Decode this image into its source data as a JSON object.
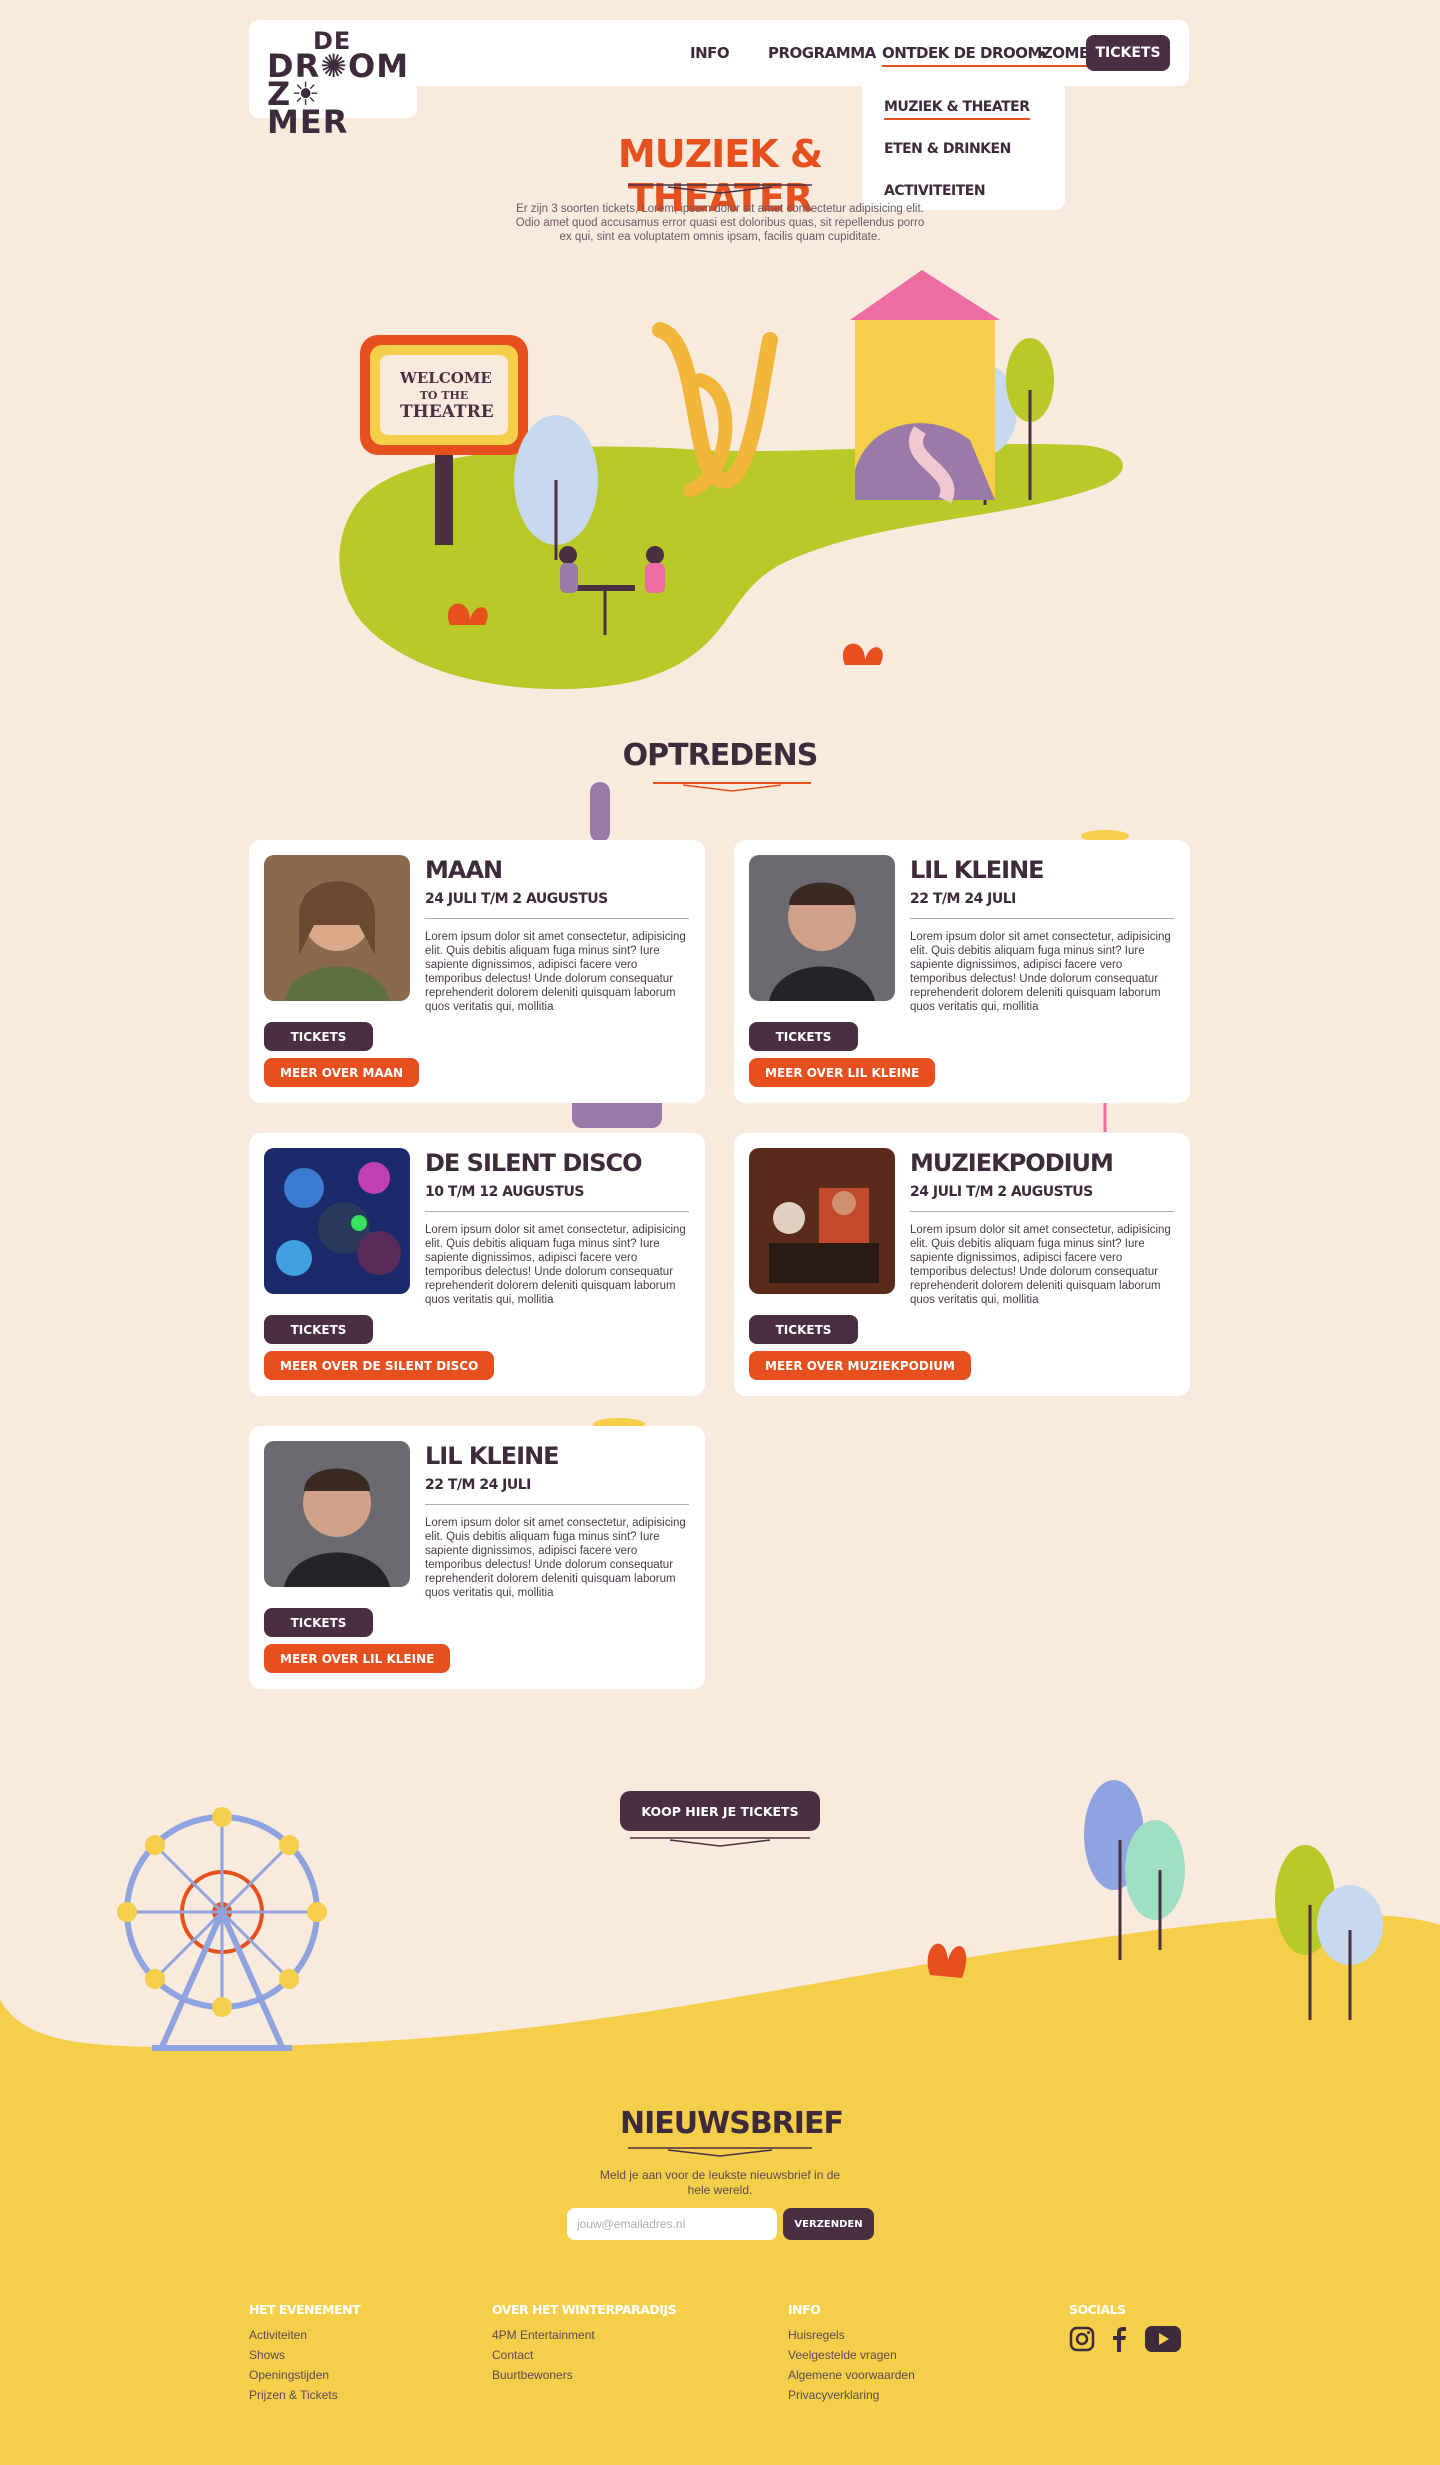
{
  "header": {
    "logo_lines": [
      "DE",
      "DR✺OM",
      "Z☀MER"
    ],
    "nav": [
      "INFO",
      "PROGRAMMA",
      "ONTDEK DE DROOMZOMER"
    ],
    "tickets_label": "TICKETS",
    "dropdown": [
      "MUZIEK & THEATER",
      "ETEN & DRINKEN",
      "ACTIVITEITEN"
    ]
  },
  "hero": {
    "title": "MUZIEK & THEATER",
    "text": "Er zijn 3 soorten tickets, Lorem, ipsum dolor sit amet consectetur adipisicing elit. Odio amet quod accusamus error quasi est doloribus quas, sit repellendus porro ex qui, sint ea voluptatem omnis ipsam, facilis quam cupiditate.",
    "sign": [
      "WELCOME",
      "TO THE",
      "THEATRE"
    ]
  },
  "section_title": "OPTREDENS",
  "cards": [
    {
      "name": "MAAN",
      "date": "24 JULI T/M 2 AUGUSTUS",
      "text": "Lorem ipsum dolor sit amet consectetur, adipisicing elit. Quis debitis aliquam fuga minus sint? Iure sapiente dignissimos, adipisci facere vero temporibus delectus! Unde dolorum consequatur reprehenderit dolorem deleniti quisquam laborum quos veritatis qui, mollitia",
      "tickets": "TICKETS",
      "more": "MEER OVER MAAN"
    },
    {
      "name": "LIL KLEINE",
      "date": "22 T/M 24 JULI",
      "text": "Lorem ipsum dolor sit amet consectetur, adipisicing elit. Quis debitis aliquam fuga minus sint? Iure sapiente dignissimos, adipisci facere vero temporibus delectus! Unde dolorum consequatur reprehenderit dolorem deleniti quisquam laborum quos veritatis qui, mollitia",
      "tickets": "TICKETS",
      "more": "MEER OVER LIL KLEINE"
    },
    {
      "name": "DE SILENT DISCO",
      "date": "10 T/M 12 AUGUSTUS",
      "text": "Lorem ipsum dolor sit amet consectetur, adipisicing elit. Quis debitis aliquam fuga minus sint? Iure sapiente dignissimos, adipisci facere vero temporibus delectus! Unde dolorum consequatur reprehenderit dolorem deleniti quisquam laborum quos veritatis qui, mollitia",
      "tickets": "TICKETS",
      "more": "MEER OVER DE SILENT DISCO"
    },
    {
      "name": "MUZIEKPODIUM",
      "date": "24 JULI T/M 2 AUGUSTUS",
      "text": "Lorem ipsum dolor sit amet consectetur, adipisicing elit. Quis debitis aliquam fuga minus sint? Iure sapiente dignissimos, adipisci facere vero temporibus delectus! Unde dolorum consequatur reprehenderit dolorem deleniti quisquam laborum quos veritatis qui, mollitia",
      "tickets": "TICKETS",
      "more": "MEER OVER MUZIEKPODIUM"
    },
    {
      "name": "LIL KLEINE",
      "date": "22 T/M 24 JULI",
      "text": "Lorem ipsum dolor sit amet consectetur, adipisicing elit. Quis debitis aliquam fuga minus sint? Iure sapiente dignissimos, adipisci facere vero temporibus delectus! Unde dolorum consequatur reprehenderit dolorem deleniti quisquam laborum quos veritatis qui, mollitia",
      "tickets": "TICKETS",
      "more": "MEER OVER LIL KLEINE"
    }
  ],
  "buy": {
    "label": "KOOP HIER JE TICKETS"
  },
  "newsletter": {
    "title": "NIEUWSBRIEF",
    "text": "Meld je aan voor de leukste nieuwsbrief in de hele wereld.",
    "placeholder": "jouw@emailadres.nl",
    "button": "VERZENDEN"
  },
  "footer": {
    "columns": [
      {
        "head": "HET EVENEMENT",
        "links": [
          "Activiteiten",
          "Shows",
          "Openingstijden",
          "Prijzen & Tickets"
        ]
      },
      {
        "head": "OVER HET WINTERPARADIJS",
        "links": [
          "4PM Entertainment",
          "Contact",
          "Buurtbewoners"
        ]
      },
      {
        "head": "INFO",
        "links": [
          "Huisregels",
          "Veelgestelde vragen",
          "Algemene voorwaarden",
          "Privacyverklaring"
        ]
      },
      {
        "head": "SOCIALS",
        "links": []
      }
    ],
    "social_icons": [
      "instagram-icon",
      "facebook-icon",
      "youtube-icon"
    ]
  },
  "colors": {
    "accent": "#e5501e",
    "dark": "#4a2f43",
    "background": "#f8eadc",
    "ground": "#f5cf4a",
    "grass": "#b8c928"
  }
}
